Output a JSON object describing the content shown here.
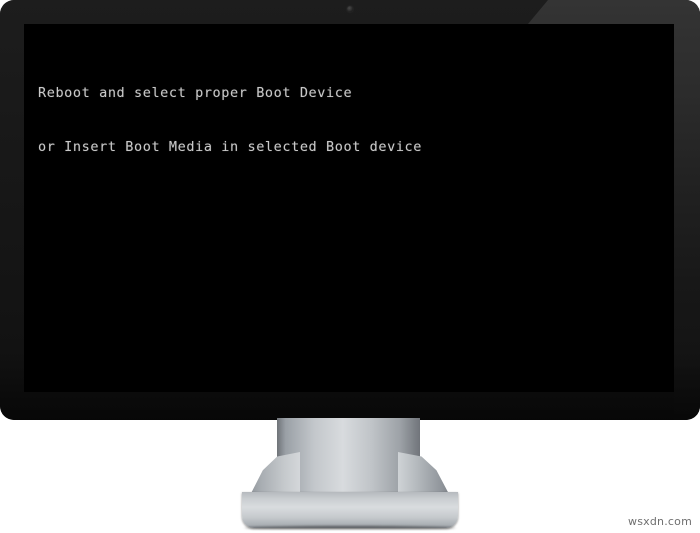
{
  "device": {
    "type": "desktop-monitor",
    "bezel_color": "#151515",
    "bezel_highlight_color": "#333333",
    "screen_color": "#000000",
    "stand_color": "#d4d7da",
    "webcam_label": "webcam"
  },
  "screen": {
    "text_color": "#c9c9c9",
    "lines": [
      "Reboot and select proper Boot Device",
      "or Insert Boot Media in selected Boot device"
    ]
  },
  "watermark": {
    "text": "wsxdn.com",
    "color": "#6f6f6f"
  }
}
